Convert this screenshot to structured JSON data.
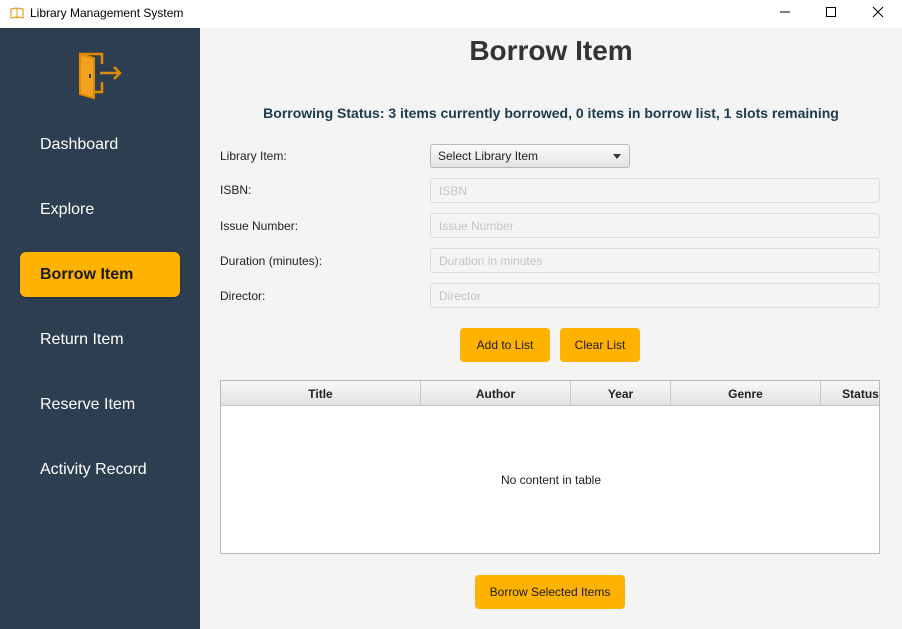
{
  "window": {
    "title": "Library Management System",
    "icon": "book-icon"
  },
  "sidebar": {
    "logo": "exit-door-icon",
    "items": [
      {
        "label": "Dashboard"
      },
      {
        "label": "Explore"
      },
      {
        "label": "Borrow Item",
        "active": true
      },
      {
        "label": "Return Item"
      },
      {
        "label": "Reserve Item"
      },
      {
        "label": "Activity Record"
      }
    ]
  },
  "main": {
    "title": "Borrow Item",
    "status": "Borrowing Status: 3 items currently borrowed, 0 items in borrow list, 1 slots remaining",
    "form": {
      "library_item_label": "Library Item:",
      "library_item_value": "Select Library Item",
      "isbn_label": "ISBN:",
      "isbn_placeholder": "ISBN",
      "issue_label": "Issue Number:",
      "issue_placeholder": "Issue Number",
      "duration_label": "Duration (minutes):",
      "duration_placeholder": "Duration in minutes",
      "director_label": "Director:",
      "director_placeholder": "Director"
    },
    "buttons": {
      "add": "Add to List",
      "clear": "Clear List",
      "borrow": "Borrow Selected Items"
    },
    "table": {
      "columns": [
        "Title",
        "Author",
        "Year",
        "Genre",
        "Status"
      ],
      "empty_message": "No content in table"
    }
  },
  "colors": {
    "sidebar_bg": "#2c3e50",
    "accent": "#ffb300",
    "status_text": "#1b3a4b"
  }
}
